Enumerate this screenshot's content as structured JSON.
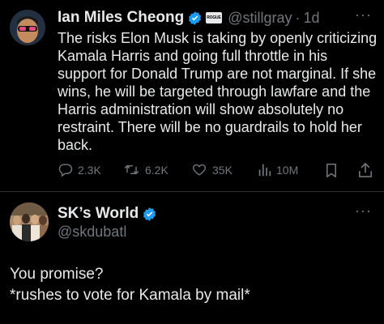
{
  "tweet": {
    "author_name": "Ian Miles Cheong",
    "affiliate_badge": "ROGUE",
    "handle": "@stillgray",
    "separator": "·",
    "time": "1d",
    "more": "···",
    "lines": [
      "The risks Elon Musk is taking by openly criticizing",
      "Kamala Harris and going full throttle in his",
      "support for Donald Trump are not marginal. If she",
      "wins, he will be targeted through lawfare and the",
      "Harris administration will show absolutely no",
      "restraint. There will be no guardrails to hold her",
      "back."
    ],
    "actions": {
      "replies": "2.3K",
      "reposts": "6.2K",
      "likes": "35K",
      "views": "10M"
    }
  },
  "reply": {
    "author_name": "SK’s World",
    "handle": "@skdubatl",
    "more": "···",
    "lines": [
      "You promise?",
      "*rushes to vote for Kamala by mail*"
    ]
  },
  "colors": {
    "background": "#000000",
    "text": "#e7e9ea",
    "muted": "#71767b",
    "verified": "#1d9bf0"
  }
}
